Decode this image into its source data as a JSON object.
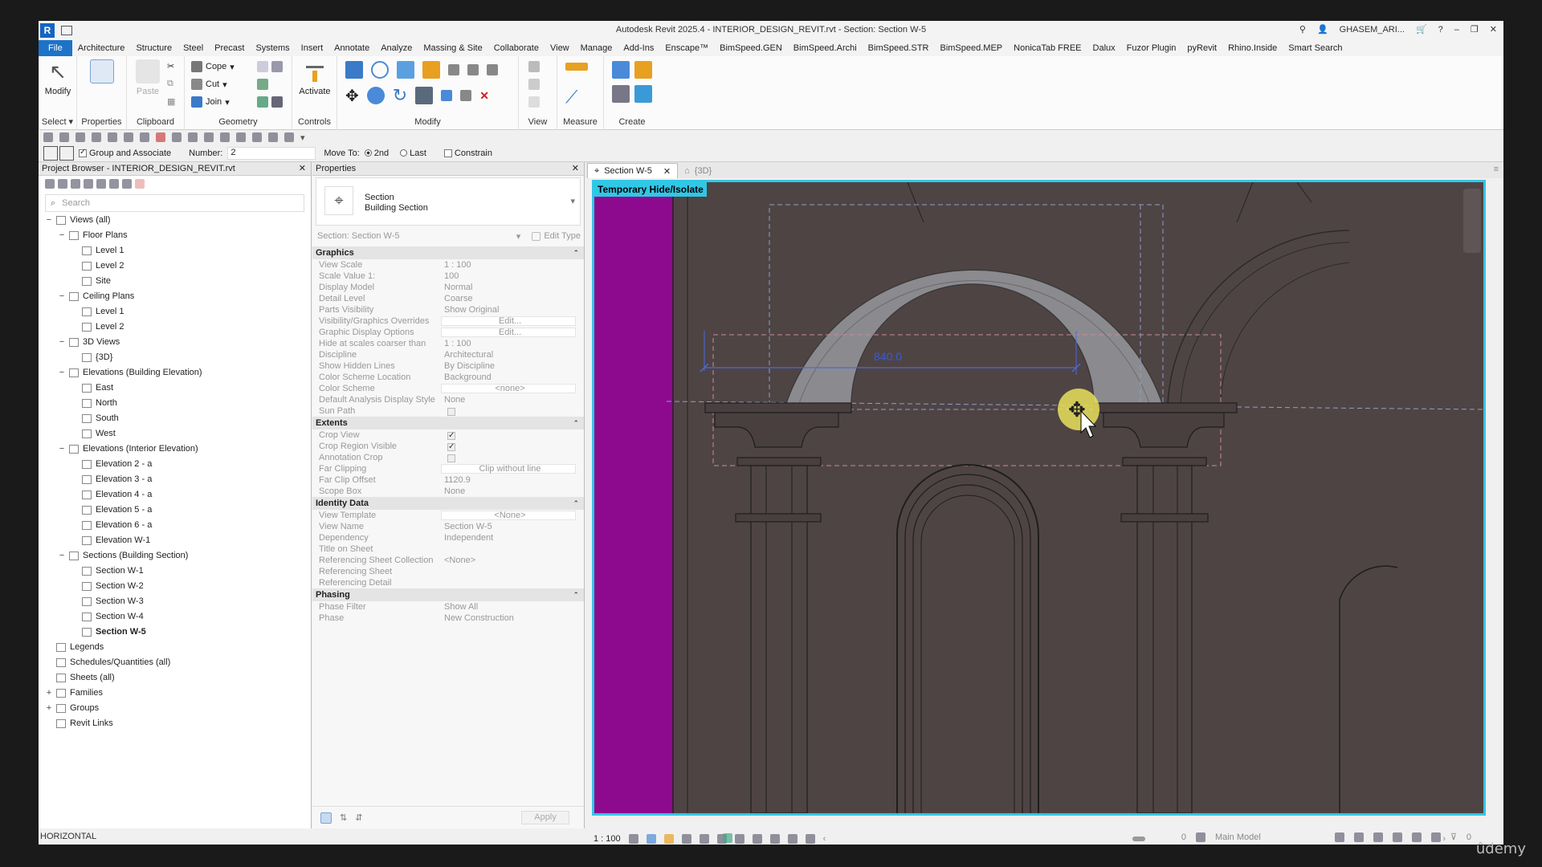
{
  "window": {
    "title": "Autodesk Revit 2025.4 - INTERIOR_DESIGN_REVIT.rvt - Section: Section W-5",
    "user": "GHASEM_ARI..."
  },
  "menu": [
    "File",
    "Architecture",
    "Structure",
    "Steel",
    "Precast",
    "Systems",
    "Insert",
    "Annotate",
    "Analyze",
    "Massing & Site",
    "Collaborate",
    "View",
    "Manage",
    "Add-Ins",
    "Enscape™",
    "BimSpeed.GEN",
    "BimSpeed.Archi",
    "BimSpeed.STR",
    "BimSpeed.MEP",
    "NonicaTab FREE",
    "Dalux",
    "Fuzor Plugin",
    "pyRevit",
    "Rhino.Inside",
    "Smart Search"
  ],
  "ribbon": {
    "modify": "Modify",
    "select": "Select ▾",
    "properties": "Properties",
    "paste": "Paste",
    "clipboard": "Clipboard",
    "cope": "Cope",
    "cut": "Cut",
    "join": "Join",
    "geometry": "Geometry",
    "activate": "Activate",
    "controls": "Controls",
    "modify_group": "Modify",
    "view": "View",
    "measure": "Measure",
    "create": "Create"
  },
  "options": {
    "group_and_associate": "Group and Associate",
    "number_label": "Number:",
    "number_value": "2",
    "move_to": "Move To:",
    "opt_2nd": "2nd",
    "opt_last": "Last",
    "constrain": "Constrain"
  },
  "project_browser": {
    "title": "Project Browser - INTERIOR_DESIGN_REVIT.rvt",
    "search_placeholder": "Search",
    "nodes": [
      {
        "label": "Views (all)",
        "kind": "group",
        "exp": "−",
        "lvl": 0
      },
      {
        "label": "Floor Plans",
        "kind": "group",
        "exp": "−",
        "lvl": 1
      },
      {
        "label": "Level 1",
        "kind": "view",
        "lvl": 2
      },
      {
        "label": "Level 2",
        "kind": "view",
        "lvl": 2
      },
      {
        "label": "Site",
        "kind": "view",
        "lvl": 2
      },
      {
        "label": "Ceiling Plans",
        "kind": "group",
        "exp": "−",
        "lvl": 1
      },
      {
        "label": "Level 1",
        "kind": "view",
        "lvl": 2
      },
      {
        "label": "Level 2",
        "kind": "view",
        "lvl": 2
      },
      {
        "label": "3D Views",
        "kind": "group",
        "exp": "−",
        "lvl": 1
      },
      {
        "label": "{3D}",
        "kind": "view",
        "lvl": 2
      },
      {
        "label": "Elevations (Building Elevation)",
        "kind": "group",
        "exp": "−",
        "lvl": 1
      },
      {
        "label": "East",
        "kind": "view",
        "lvl": 2
      },
      {
        "label": "North",
        "kind": "view",
        "lvl": 2
      },
      {
        "label": "South",
        "kind": "view",
        "lvl": 2
      },
      {
        "label": "West",
        "kind": "view",
        "lvl": 2
      },
      {
        "label": "Elevations (Interior Elevation)",
        "kind": "group",
        "exp": "−",
        "lvl": 1
      },
      {
        "label": "Elevation 2 - a",
        "kind": "view",
        "lvl": 2
      },
      {
        "label": "Elevation 3 - a",
        "kind": "view",
        "lvl": 2
      },
      {
        "label": "Elevation 4 - a",
        "kind": "view",
        "lvl": 2
      },
      {
        "label": "Elevation 5 - a",
        "kind": "view",
        "lvl": 2
      },
      {
        "label": "Elevation 6 - a",
        "kind": "view",
        "lvl": 2
      },
      {
        "label": "Elevation W-1",
        "kind": "view",
        "lvl": 2
      },
      {
        "label": "Sections (Building Section)",
        "kind": "group",
        "exp": "−",
        "lvl": 1
      },
      {
        "label": "Section W-1",
        "kind": "view",
        "lvl": 2
      },
      {
        "label": "Section W-2",
        "kind": "view",
        "lvl": 2
      },
      {
        "label": "Section W-3",
        "kind": "view",
        "lvl": 2
      },
      {
        "label": "Section W-4",
        "kind": "view",
        "lvl": 2
      },
      {
        "label": "Section W-5",
        "kind": "view",
        "lvl": 2,
        "bold": true
      },
      {
        "label": "Legends",
        "kind": "view",
        "lvl": 0
      },
      {
        "label": "Schedules/Quantities (all)",
        "kind": "view",
        "lvl": 0
      },
      {
        "label": "Sheets (all)",
        "kind": "view",
        "lvl": 0
      },
      {
        "label": "Families",
        "kind": "group",
        "exp": "+",
        "lvl": 0
      },
      {
        "label": "Groups",
        "kind": "group",
        "exp": "+",
        "lvl": 0
      },
      {
        "label": "Revit Links",
        "kind": "view",
        "lvl": 0
      }
    ]
  },
  "properties": {
    "title": "Properties",
    "type_line1": "Section",
    "type_line2": "Building Section",
    "instance": "Section: Section W-5",
    "edit_type": "Edit Type",
    "apply": "Apply",
    "sections": [
      {
        "name": "Graphics",
        "rows": [
          [
            "View Scale",
            "1 : 100",
            false
          ],
          [
            "Scale Value    1:",
            "100",
            false
          ],
          [
            "Display Model",
            "Normal",
            false
          ],
          [
            "Detail Level",
            "Coarse",
            false
          ],
          [
            "Parts Visibility",
            "Show Original",
            false
          ],
          [
            "Visibility/Graphics Overrides",
            "Edit...",
            true
          ],
          [
            "Graphic Display Options",
            "Edit...",
            true
          ],
          [
            "Hide at scales coarser than",
            "1 : 100",
            false
          ],
          [
            "Discipline",
            "Architectural",
            false
          ],
          [
            "Show Hidden Lines",
            "By Discipline",
            false
          ],
          [
            "Color Scheme Location",
            "Background",
            false
          ],
          [
            "Color Scheme",
            "<none>",
            true
          ],
          [
            "Default Analysis Display Style",
            "None",
            false
          ],
          [
            "Sun Path",
            "",
            false
          ]
        ]
      },
      {
        "name": "Extents",
        "rows": [
          [
            "Crop View",
            "",
            false
          ],
          [
            "Crop Region Visible",
            "",
            false
          ],
          [
            "Annotation Crop",
            "",
            false
          ],
          [
            "Far Clipping",
            "Clip without line",
            true
          ],
          [
            "Far Clip Offset",
            "1120.9",
            false
          ],
          [
            "Scope Box",
            "None",
            false
          ]
        ]
      },
      {
        "name": "Identity Data",
        "rows": [
          [
            "View Template",
            "<None>",
            true
          ],
          [
            "View Name",
            "Section W-5",
            false
          ],
          [
            "Dependency",
            "Independent",
            false
          ],
          [
            "Title on Sheet",
            "",
            false
          ],
          [
            "Referencing Sheet Collection",
            "<None>",
            false
          ],
          [
            "Referencing Sheet",
            "",
            false
          ],
          [
            "Referencing Detail",
            "",
            false
          ]
        ]
      },
      {
        "name": "Phasing",
        "rows": [
          [
            "Phase Filter",
            "Show All",
            false
          ],
          [
            "Phase",
            "New Construction",
            false
          ]
        ]
      }
    ]
  },
  "view_tabs": [
    {
      "label": "Section W-5",
      "active": true
    },
    {
      "label": "{3D}",
      "active": false
    }
  ],
  "canvas": {
    "banner": "Temporary Hide/Isolate",
    "dimension_text": "840.0",
    "colors": {
      "wall": "#4e4343",
      "accent": "#8d0a8f",
      "arch": "#8b8b8f",
      "frame": "#31c7e6"
    }
  },
  "view_controls": {
    "scale": "1 : 100"
  },
  "status": {
    "text": "HORIZONTAL",
    "model": "Main Model",
    "filter_count": "0",
    "sel_count": "0"
  },
  "watermark": "ûdemy"
}
